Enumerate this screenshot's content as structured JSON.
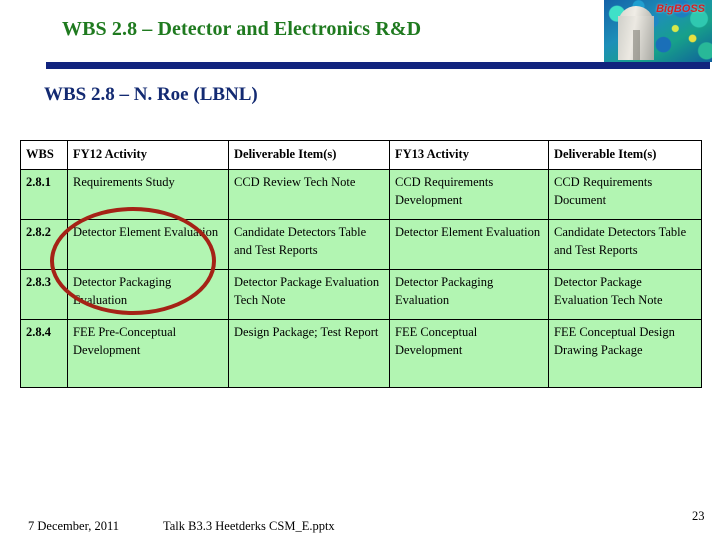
{
  "slide": {
    "title": "WBS 2.8 – Detector and Electronics R&D",
    "subtitle": "WBS 2.8 – N. Roe (LBNL)",
    "title_color": "#1f7a1f",
    "subtitle_color": "#132a72",
    "rule_color": "#11247e"
  },
  "logo": {
    "text": "BigBOSS",
    "text_color": "#d82020",
    "icon": "telescope-dome-icon"
  },
  "table": {
    "header_background": "#ffffff",
    "row_background": "#b2f5b2",
    "border_color": "#000000",
    "columns": [
      "WBS",
      "FY12 Activity",
      "Deliverable Item(s)",
      "FY13 Activity",
      "Deliverable Item(s)"
    ],
    "rows": [
      {
        "wbs": "2.8.1",
        "fy12_activity": "Requirements Study",
        "fy12_deliverable": "CCD Review Tech Note",
        "fy13_activity": "CCD Requirements Development",
        "fy13_deliverable": "CCD Requirements Document"
      },
      {
        "wbs": "2.8.2",
        "fy12_activity": "Detector Element Evaluation",
        "fy12_deliverable": "Candidate Detectors Table and Test Reports",
        "fy13_activity": "Detector Element Evaluation",
        "fy13_deliverable": "Candidate Detectors Table and Test Reports"
      },
      {
        "wbs": "2.8.3",
        "fy12_activity": "Detector Packaging Evaluation",
        "fy12_deliverable": "Detector Package Evaluation Tech Note",
        "fy13_activity": "Detector Packaging Evaluation",
        "fy13_deliverable": "Detector Package Evaluation Tech Note"
      },
      {
        "wbs": "2.8.4",
        "fy12_activity": "FEE Pre-Conceptual Development",
        "fy12_deliverable": "Design Package; Test Report",
        "fy13_activity": "FEE Conceptual Development",
        "fy13_deliverable": "FEE Conceptual Design Drawing Package"
      }
    ]
  },
  "annotation": {
    "shape": "ellipse",
    "color": "#a52216"
  },
  "footer": {
    "date": "7 December, 2011",
    "file": "Talk B3.3 Heetderks CSM_E.pptx",
    "page_number": "23"
  }
}
